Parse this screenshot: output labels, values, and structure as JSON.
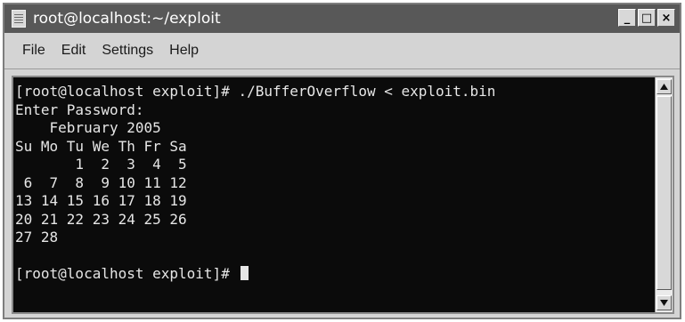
{
  "window": {
    "title": "root@localhost:~/exploit"
  },
  "controls": {
    "minimize": "_",
    "maximize": "□",
    "close": "×"
  },
  "menu": [
    {
      "label": "File"
    },
    {
      "label": "Edit"
    },
    {
      "label": "Settings"
    },
    {
      "label": "Help"
    }
  ],
  "terminal": {
    "lines": [
      "[root@localhost exploit]# ./BufferOverflow < exploit.bin",
      "Enter Password:",
      "    February 2005",
      "Su Mo Tu We Th Fr Sa",
      "       1  2  3  4  5",
      " 6  7  8  9 10 11 12",
      "13 14 15 16 17 18 19",
      "20 21 22 23 24 25 26",
      "27 28",
      "",
      "[root@localhost exploit]# "
    ]
  },
  "icons": {
    "app": "terminal-icon",
    "scroll_up": "arrow-up-icon",
    "scroll_down": "arrow-down-icon"
  }
}
